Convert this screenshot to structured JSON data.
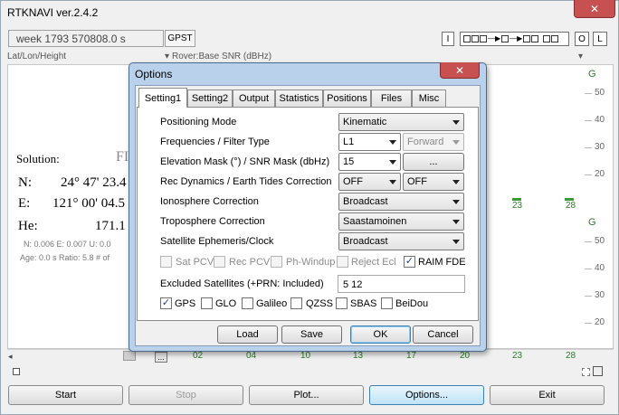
{
  "main": {
    "title": "RTKNAVI ver.2.4.2",
    "close_glyph": "✕",
    "time": "week 1793 570808.0 s",
    "time_system_button": "GPST",
    "input_button": "I",
    "output_button": "O",
    "log_button": "L",
    "left_selector": "Lat/Lon/Height",
    "right_selector": "Rover:Base SNR (dBHz)",
    "solution_label": "Solution:",
    "solution_value": "FI",
    "n_label": "N:",
    "n_value": "24° 47' 23.4",
    "e_label": "E:",
    "e_value": "121° 00' 04.5",
    "h_label": "He:",
    "h_value": "171.1",
    "std_line": "N: 0.006 E: 0.007 U: 0.0",
    "age_line": "Age: 0.0 s Ratio: 5.8 # of",
    "plot_top": {
      "label": "G",
      "ticks": [
        "50",
        "40",
        "30",
        "20"
      ]
    },
    "plot_bottom": {
      "label": "G",
      "ticks": [
        "50",
        "40",
        "30",
        "20"
      ],
      "x_ticks_partial": [
        "23",
        "28"
      ]
    },
    "x_ticks": [
      "02",
      "04",
      "10",
      "13",
      "17",
      "20",
      "23",
      "28"
    ],
    "ellipsis_button": "...",
    "buttons": {
      "start": "Start",
      "stop": "Stop",
      "plot": "Plot...",
      "options": "Options...",
      "exit": "Exit"
    }
  },
  "options": {
    "title": "Options",
    "close_glyph": "✕",
    "tabs": [
      "Setting1",
      "Setting2",
      "Output",
      "Statistics",
      "Positions",
      "Files",
      "Misc"
    ],
    "fields": {
      "positioning_mode": {
        "label": "Positioning Mode",
        "value": "Kinematic"
      },
      "frequencies": {
        "label": "Frequencies / Filter Type",
        "value": "L1",
        "filter": "Forward"
      },
      "elevation_mask": {
        "label": "Elevation Mask (°) / SNR Mask (dbHz)",
        "value": "15",
        "button": "..."
      },
      "rec_dynamics": {
        "label": "Rec Dynamics / Earth Tides Correction",
        "value": "OFF",
        "tides": "OFF"
      },
      "ionosphere": {
        "label": "Ionosphere Correction",
        "value": "Broadcast"
      },
      "troposphere": {
        "label": "Troposphere Correction",
        "value": "Saastamoinen"
      },
      "ephemeris": {
        "label": "Satellite Ephemeris/Clock",
        "value": "Broadcast"
      }
    },
    "checks": {
      "sat_pcv": "Sat PCV",
      "rec_pcv": "Rec PCV",
      "ph_windup": "Ph-Windup",
      "reject_ecl": "Reject Ecl",
      "raim_fde": "RAIM FDE"
    },
    "excluded": {
      "label": "Excluded Satellites (+PRN: Included)",
      "value": "5 12"
    },
    "systems": {
      "gps": "GPS",
      "glo": "GLO",
      "galileo": "Galileo",
      "qzss": "QZSS",
      "sbas": "SBAS",
      "beidou": "BeiDou"
    },
    "check_mark": "✓",
    "buttons": {
      "load": "Load",
      "save": "Save",
      "ok": "OK",
      "cancel": "Cancel"
    }
  }
}
